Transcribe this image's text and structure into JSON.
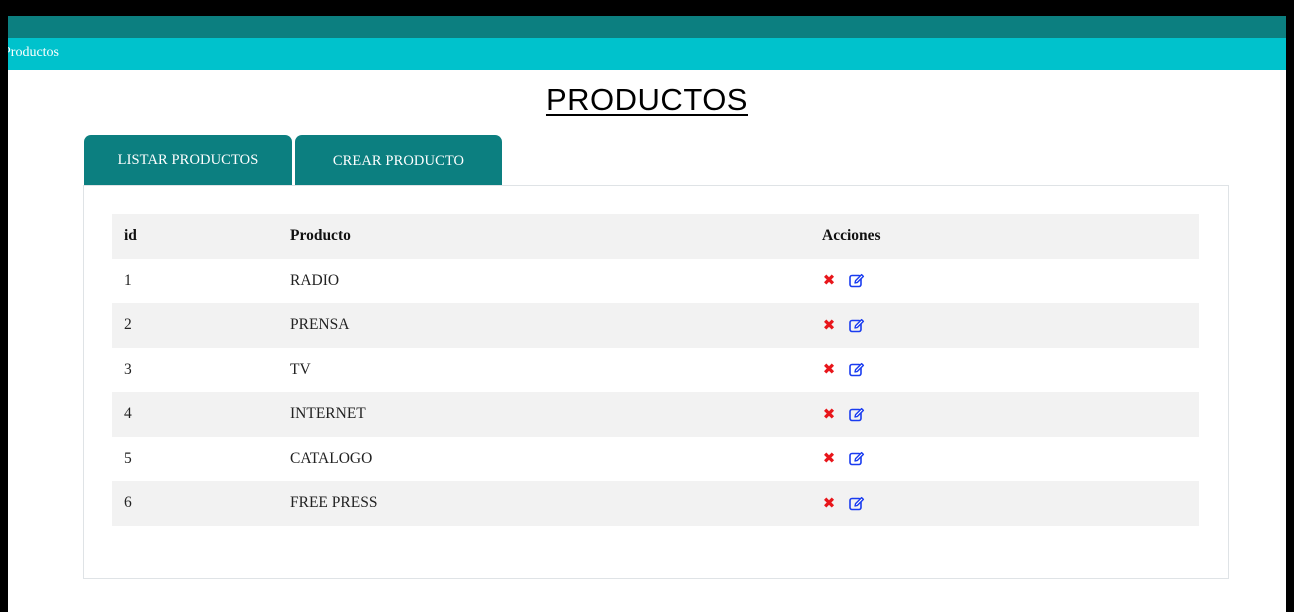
{
  "app": {
    "brand": "Productos"
  },
  "page": {
    "title": "PRODUCTOS"
  },
  "tabs": [
    {
      "label": "LISTAR PRODUCTOS"
    },
    {
      "label": "CREAR PRODUCTO"
    }
  ],
  "table": {
    "headers": {
      "id": "id",
      "product": "Producto",
      "actions": "Acciones"
    },
    "rows": [
      {
        "id": "1",
        "product": "RADIO"
      },
      {
        "id": "2",
        "product": "PRENSA"
      },
      {
        "id": "3",
        "product": "TV"
      },
      {
        "id": "4",
        "product": "INTERNET"
      },
      {
        "id": "5",
        "product": "CATALOGO"
      },
      {
        "id": "6",
        "product": "FREE PRESS"
      }
    ],
    "row_actions": {
      "delete_icon": "close-icon",
      "edit_icon": "edit-icon"
    }
  },
  "colors": {
    "topbar_dark": "#0c7f80",
    "topbar": "#00c2cc",
    "tab_bg": "#0c7f80",
    "delete": "#e8161b",
    "edit": "#1a3cf0"
  }
}
